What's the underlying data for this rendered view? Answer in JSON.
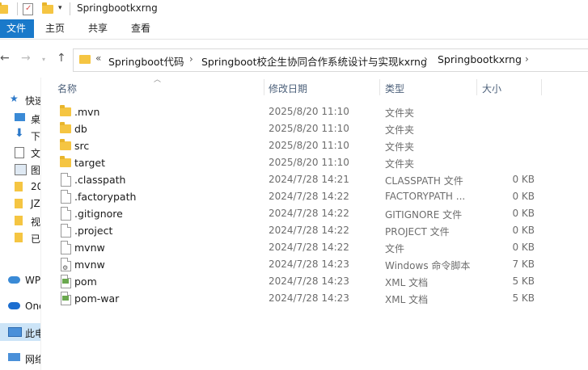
{
  "window": {
    "title": "Springbootkxrng"
  },
  "ribbon": {
    "tabs": [
      "文件",
      "主页",
      "共享",
      "查看"
    ]
  },
  "address": {
    "prefix": "«",
    "crumbs": [
      "Springboot代码",
      "Springboot校企生协同合作系统设计与实现kxrng",
      "Springbootkxrng"
    ]
  },
  "nav": {
    "items": [
      {
        "label": "快速",
        "icon": "star-icon"
      },
      {
        "label": "桌",
        "icon": "desktop-icon"
      },
      {
        "label": "下",
        "icon": "download-icon"
      },
      {
        "label": "文",
        "icon": "document-icon"
      },
      {
        "label": "图",
        "icon": "picture-icon"
      },
      {
        "label": "20",
        "icon": "folder-icon"
      },
      {
        "label": "JZ",
        "icon": "folder-icon"
      },
      {
        "label": "视",
        "icon": "folder-icon"
      },
      {
        "label": "已",
        "icon": "folder-icon"
      },
      {
        "label": "WP",
        "icon": "cloud-icon"
      },
      {
        "label": "One",
        "icon": "onedrive-icon"
      },
      {
        "label": "此电",
        "icon": "computer-icon"
      },
      {
        "label": "网络",
        "icon": "network-icon"
      }
    ]
  },
  "columns": {
    "name": "名称",
    "date": "修改日期",
    "type": "类型",
    "size": "大小"
  },
  "files": [
    {
      "name": ".mvn",
      "date": "2025/8/20 11:10",
      "type": "文件夹",
      "size": "",
      "icon": "folder-icon"
    },
    {
      "name": "db",
      "date": "2025/8/20 11:10",
      "type": "文件夹",
      "size": "",
      "icon": "folder-icon"
    },
    {
      "name": "src",
      "date": "2025/8/20 11:10",
      "type": "文件夹",
      "size": "",
      "icon": "folder-icon"
    },
    {
      "name": "target",
      "date": "2025/8/20 11:10",
      "type": "文件夹",
      "size": "",
      "icon": "folder-icon"
    },
    {
      "name": ".classpath",
      "date": "2024/7/28 14:21",
      "type": "CLASSPATH 文件",
      "size": "0 KB",
      "icon": "file-icon"
    },
    {
      "name": ".factorypath",
      "date": "2024/7/28 14:22",
      "type": "FACTORYPATH ...",
      "size": "0 KB",
      "icon": "file-icon"
    },
    {
      "name": ".gitignore",
      "date": "2024/7/28 14:22",
      "type": "GITIGNORE 文件",
      "size": "0 KB",
      "icon": "file-icon"
    },
    {
      "name": ".project",
      "date": "2024/7/28 14:22",
      "type": "PROJECT 文件",
      "size": "0 KB",
      "icon": "file-icon"
    },
    {
      "name": "mvnw",
      "date": "2024/7/28 14:22",
      "type": "文件",
      "size": "0 KB",
      "icon": "file-icon"
    },
    {
      "name": "mvnw",
      "date": "2024/7/28 14:23",
      "type": "Windows 命令脚本",
      "size": "7 KB",
      "icon": "script-icon"
    },
    {
      "name": "pom",
      "date": "2024/7/28 14:23",
      "type": "XML 文档",
      "size": "5 KB",
      "icon": "xml-icon"
    },
    {
      "name": "pom-war",
      "date": "2024/7/28 14:23",
      "type": "XML 文档",
      "size": "5 KB",
      "icon": "xml-icon"
    }
  ]
}
